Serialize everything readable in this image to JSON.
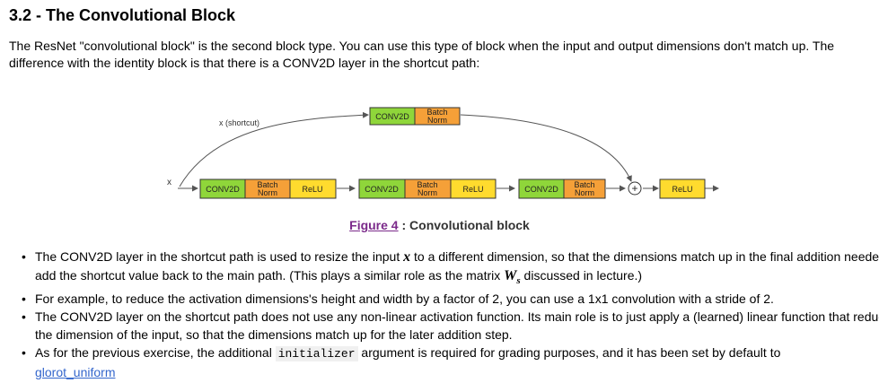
{
  "section": {
    "title": "3.2 - The Convolutional Block",
    "intro": "The ResNet \"convolutional block\" is the second block type. You can use this type of block when the input and output dimensions don't match up. The difference with the identity block is that there is a CONV2D layer in the shortcut path:"
  },
  "diagram": {
    "input_label": "x",
    "shortcut_label": "x (shortcut)",
    "conv_label": "CONV2D",
    "bn_label_1": "Batch",
    "bn_label_2": "Norm",
    "relu_label": "ReLU",
    "add_symbol": "+",
    "colors": {
      "conv": "#8fd63a",
      "bn": "#f5a038",
      "relu": "#ffdb2e",
      "line": "#555555"
    }
  },
  "caption": {
    "link": "Figure 4",
    "text": " : Convolutional block"
  },
  "bullets": {
    "b1_a": "The CONV2D layer in the shortcut path is used to resize the input ",
    "b1_x": "x",
    "b1_b": " to a different dimension, so that the dimensions match up in the final addition needed to add the shortcut value back to the main path. (This plays a similar role as the matrix ",
    "b1_w": "W",
    "b1_ws": "s",
    "b1_c": " discussed in lecture.)",
    "b2": "For example, to reduce the activation dimensions's height and width by a factor of 2, you can use a 1x1 convolution with a stride of 2.",
    "b3": "The CONV2D layer on the shortcut path does not use any non-linear activation function. Its main role is to just apply a (learned) linear function that reduces the dimension of the input, so that the dimensions match up for the later addition step.",
    "b4_a": "As for the previous exercise, the additional ",
    "b4_code": "initializer",
    "b4_b": " argument is required for grading purposes, and it has been set by default to ",
    "b4_link": "glorot_uniform"
  }
}
